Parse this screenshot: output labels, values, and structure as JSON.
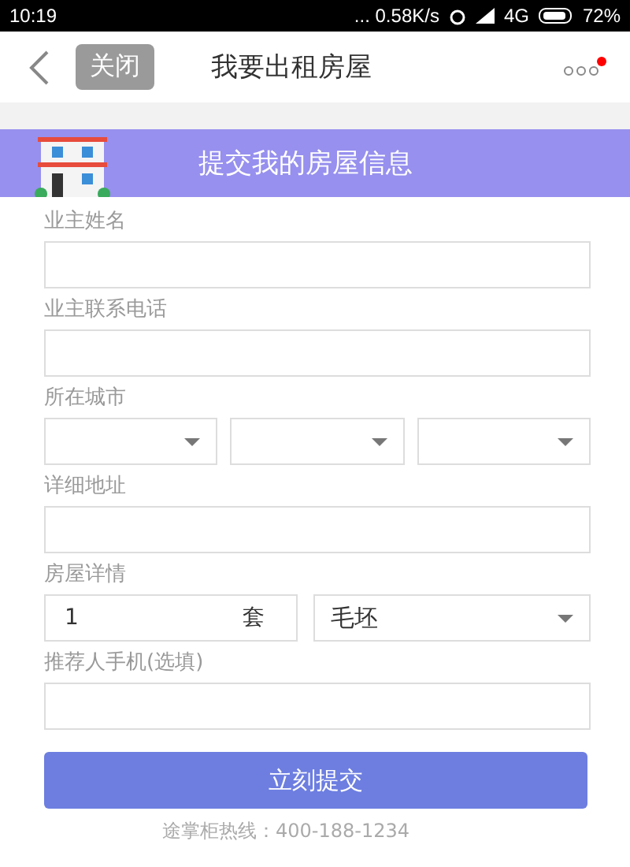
{
  "status_bar": {
    "time": "10:19",
    "network_speed": "... 0.58K/s",
    "network": "4G",
    "battery": "72%"
  },
  "nav": {
    "close_button": "关闭",
    "title": "我要出租房屋",
    "menu_has_notification": true
  },
  "banner": {
    "title": "提交我的房屋信息"
  },
  "fields": [
    {
      "kind": "text",
      "label": "业主姓名"
    },
    {
      "kind": "text",
      "label": "业主联系电话"
    },
    {
      "kind": "selects",
      "label": "所在城市"
    },
    {
      "kind": "text",
      "label": "详细地址"
    },
    {
      "kind": "count_select",
      "label": "房屋详情",
      "value": "1",
      "unit": "套",
      "option": "毛坯"
    },
    {
      "kind": "text",
      "label": "推荐人手机(选填)"
    }
  ],
  "submit_button": "立刻提交",
  "hotline": "途掌柜热线：400-188-1234"
}
